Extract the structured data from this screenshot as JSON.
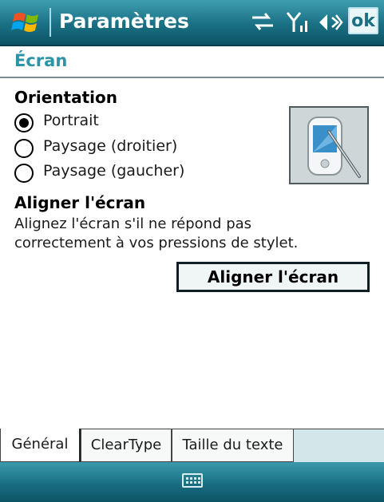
{
  "titlebar": {
    "title": "Paramètres",
    "ok_label": "ok",
    "icons": [
      "windows-start-icon",
      "connectivity-icon",
      "signal-icon",
      "speaker-icon"
    ]
  },
  "page": {
    "heading": "Écran"
  },
  "orientation": {
    "title": "Orientation",
    "options": [
      {
        "label": "Portrait",
        "selected": true
      },
      {
        "label": "Paysage (droitier)",
        "selected": false
      },
      {
        "label": "Paysage (gaucher)",
        "selected": false
      }
    ],
    "illustration": "device-stylus-icon"
  },
  "align": {
    "title": "Aligner l'écran",
    "description_line1": "Alignez l'écran s'il ne répond pas",
    "description_line2": "correctement à vos pressions de stylet.",
    "button_label": "Aligner l'écran"
  },
  "tabs": [
    {
      "label": "Général",
      "active": true
    },
    {
      "label": "ClearType",
      "active": false
    },
    {
      "label": "Taille du texte",
      "active": false
    }
  ],
  "bottombar": {
    "icon": "keyboard-icon"
  },
  "colors": {
    "titlebar": "#1a6f83",
    "heading": "#2b95a8",
    "tab_fill": "#d3e6ea"
  }
}
